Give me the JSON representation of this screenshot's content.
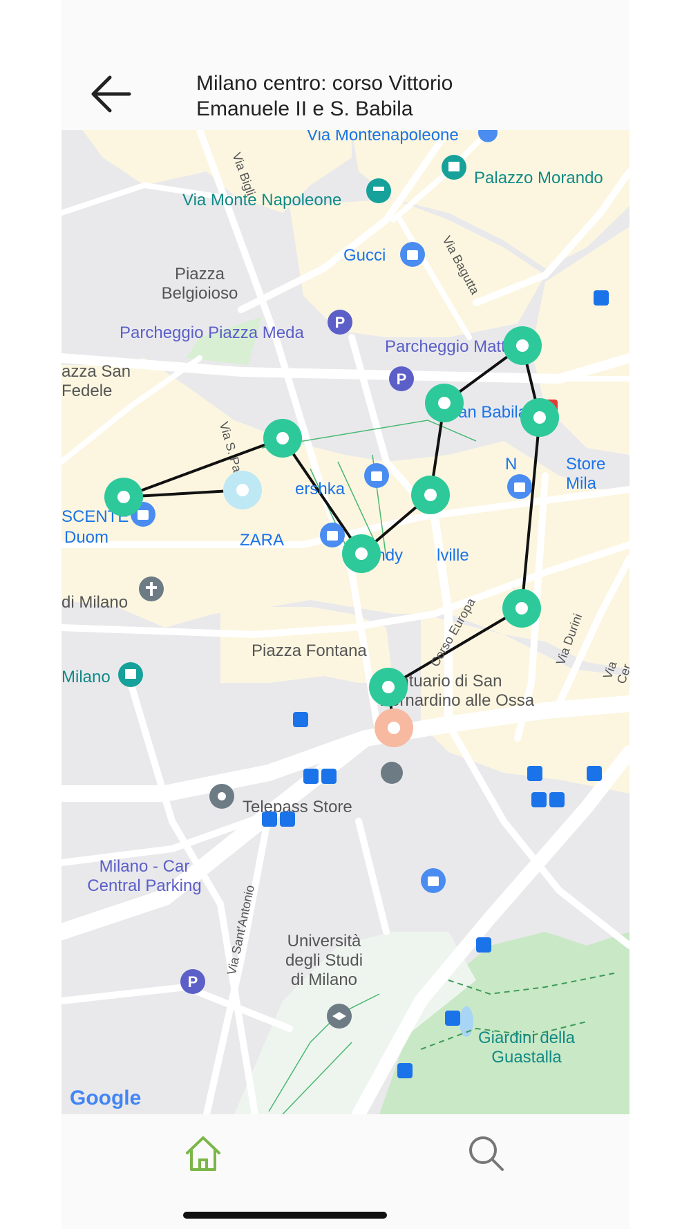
{
  "header": {
    "back_icon": "arrow-left-icon",
    "title_line1": "Milano centro: corso Vittorio",
    "title_line2": "Emanuele II e S. Babila"
  },
  "map": {
    "attribution": "Google",
    "labels": {
      "montenapoleone_top": "Via Montenapoleone",
      "palazzo_morando": "Palazzo Morando",
      "monte_napoleone": "Via Monte Napoleone",
      "via_bigli": "Via Bigli",
      "gucci": "Gucci",
      "via_bagutta": "Via Bagutta",
      "piazza_belgioioso_1": "Piazza",
      "piazza_belgioioso_2": "Belgioioso",
      "parcheggio_meda": "Parcheggio Piazza Meda",
      "parcheggio_matteotti": "Parcheggio Matteotti",
      "piazza_san_fedele_1": "azza San",
      "piazza_san_fedele_2": "Fedele",
      "san_babila": "San Babila",
      "via_s_paolo": "Via S. Paolo",
      "bershka": "ershka",
      "nike": "N",
      "nike_store": "Store Mila",
      "scente": "SCENTE",
      "duomo": "Duom",
      "zara": "ZARA",
      "brandy": "Brandy",
      "melville": "lville",
      "di_milano": "di Milano",
      "corso_europa": "Corso Europa",
      "via_durini": "Via Durini",
      "via_cerva": "Via Cer",
      "piazza_fontana": "Piazza Fontana",
      "milano_museum": "Milano",
      "santuario_1": "Santuario di San",
      "santuario_2": "Bernardino alle Ossa",
      "telepass": "Telepass Store",
      "car_parking_1": "Milano - Car",
      "car_parking_2": "Central Parking",
      "via_sant_antonio": "Via Sant'Antonio",
      "universita_1": "Università",
      "universita_2": "degli Studi",
      "universita_3": "di Milano",
      "giardini_1": "Giardini della",
      "giardini_2": "Guastalla"
    },
    "route_stops": [
      {
        "name": "stop-san-babila"
      },
      {
        "name": "stop-babila-south"
      },
      {
        "name": "stop-nike-store"
      },
      {
        "name": "stop-bershka"
      },
      {
        "name": "stop-duomo"
      },
      {
        "name": "stop-brandy-melville"
      },
      {
        "name": "stop-piazza-fontana"
      },
      {
        "name": "stop-durini"
      },
      {
        "name": "stop-santuario"
      }
    ],
    "colors": {
      "stop": "#2ec99a",
      "current_location": "#bfe8f5",
      "destination": "#f7b9a0",
      "route_line": "#111111",
      "metro": "#e53935"
    }
  },
  "bottom_nav": {
    "home_icon": "home-icon",
    "search_icon": "search-icon"
  }
}
